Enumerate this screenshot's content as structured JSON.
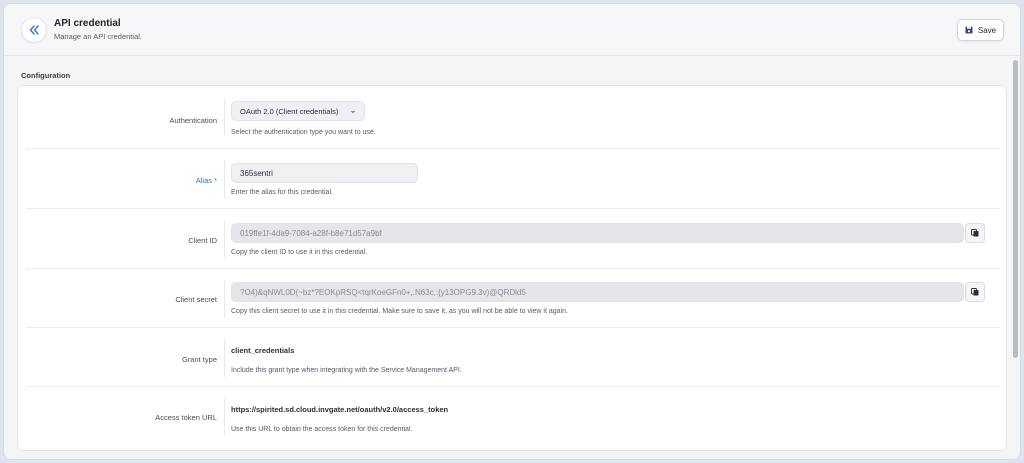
{
  "header": {
    "title": "API credential",
    "subtitle": "Manage an API credential.",
    "save_label": "Save"
  },
  "section": {
    "title": "Configuration"
  },
  "fields": {
    "authentication": {
      "label": "Authentication",
      "value": "OAuth 2.0 (Client credentials)",
      "help": "Select the authentication type you want to use."
    },
    "alias": {
      "label": "Alias *",
      "value": "365sentri",
      "help": "Enter the alias for this credential."
    },
    "client_id": {
      "label": "Client ID",
      "value": "019ffe1f-4da9-7084-a28f-b8e71d57a9bf",
      "help": "Copy the client ID to use it in this credential."
    },
    "client_secret": {
      "label": "Client secret",
      "value": "?O4)&qNWL0D(~bz*?EOKpRSQ<tqrKoeGFn0+,.N63c,:{y13OPG9.3v)@QRDld5",
      "help": "Copy this client secret to use it in this credential. Make sure to save it, as you will not be able to view it again."
    },
    "grant_type": {
      "label": "Grant type",
      "value": "client_credentials",
      "help": "Include this grant type when integrating with the Service Management API."
    },
    "access_token_url": {
      "label": "Access token URL",
      "value": "https://spirited.sd.cloud.invgate.net/oauth/v2.0/access_token",
      "help": "Use this URL to obtain the access token for this credential."
    }
  },
  "icons": {
    "back": "double-chevron-left-icon",
    "save": "floppy-disk-icon",
    "dropdown": "chevron-down-icon",
    "copy": "copy-icon"
  },
  "colors": {
    "accent": "#3c6fd6",
    "background": "#f4f5f7",
    "panel": "#ffffff"
  }
}
